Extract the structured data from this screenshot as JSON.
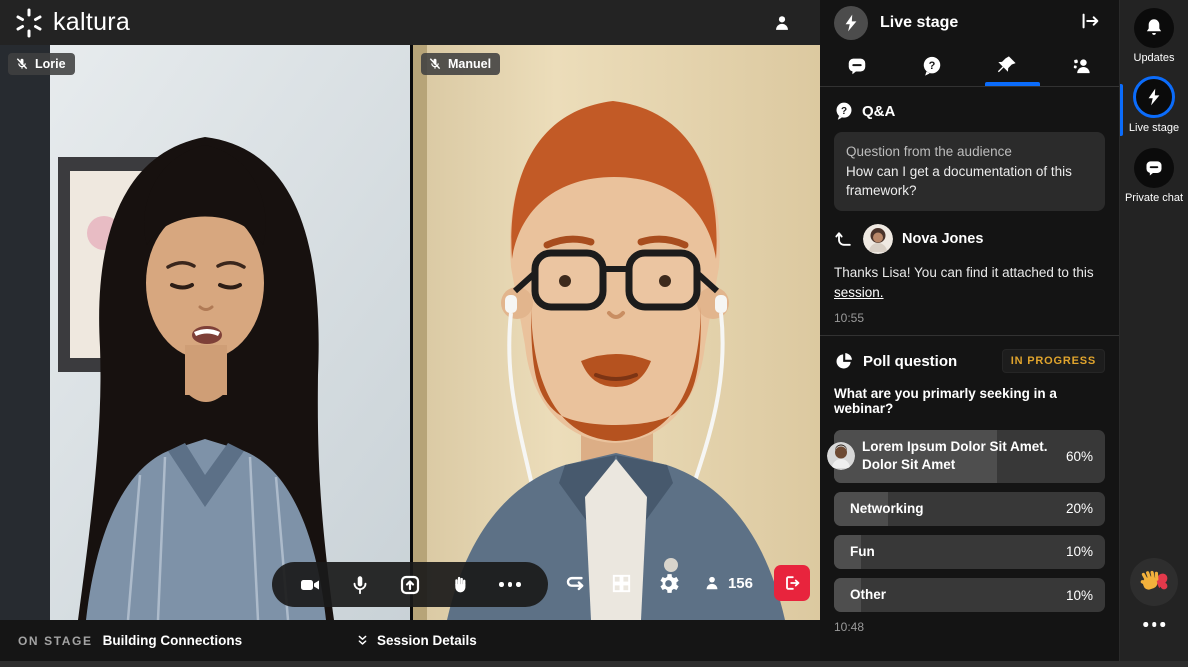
{
  "app": {
    "brand": "kaltura"
  },
  "videos": [
    {
      "label": "Lorie",
      "muted": true
    },
    {
      "label": "Manuel",
      "muted": true
    }
  ],
  "stage_controls": {
    "left_icons": [
      "camera-icon",
      "microphone-icon",
      "share-screen-icon",
      "raise-hand-icon",
      "more-icon"
    ],
    "right_icons": [
      "swap-layout-icon",
      "grid-view-icon",
      "settings-gear-icon",
      "participants-icon",
      "leave-icon"
    ],
    "participants_count": "156"
  },
  "panel": {
    "title": "Live stage",
    "tabs": [
      {
        "name": "chat",
        "active": false
      },
      {
        "name": "qa",
        "active": false
      },
      {
        "name": "pinned",
        "active": true
      },
      {
        "name": "participants",
        "active": false
      }
    ],
    "qa": {
      "section_title": "Q&A",
      "quote_line1": "Question from the audience",
      "quote_line2": "How can I get a documentation of this framework?",
      "reply_author": "Nova Jones",
      "reply_text_pre": "Thanks Lisa! You can find it attached to this ",
      "reply_link": "session.",
      "timestamp": "10:55"
    },
    "poll": {
      "section_title": "Poll question",
      "status_badge": "IN PROGRESS",
      "question": "What are you primarly seeking in a webinar?",
      "options": [
        {
          "label": "Lorem Ipsum Dolor Sit Amet. Dolor Sit Amet",
          "percent": "60%",
          "value": 60,
          "avatar": true
        },
        {
          "label": "Networking",
          "percent": "20%",
          "value": 20,
          "avatar": false
        },
        {
          "label": "Fun",
          "percent": "10%",
          "value": 10,
          "avatar": false
        },
        {
          "label": "Other",
          "percent": "10%",
          "value": 10,
          "avatar": false
        }
      ],
      "timestamp": "10:48"
    }
  },
  "rail": {
    "items": [
      {
        "label": "Updates",
        "icon": "bell-icon",
        "active": false
      },
      {
        "label": "Live stage",
        "icon": "lightning-icon",
        "active": true
      },
      {
        "label": "Private chat",
        "icon": "chat-bubble-icon",
        "active": false
      }
    ],
    "clap_icon": "clap-reaction-icon",
    "more_icon": "more-icon"
  },
  "bottom_bar": {
    "on_stage_label": "ON STAGE",
    "session_name": "Building Connections",
    "session_details_label": "Session Details"
  },
  "colors": {
    "accent_blue": "#0b6cfb",
    "badge_amber": "#e0a42d",
    "leave_red": "#e8243d",
    "topbar_bg": "#232323",
    "panel_bg": "#141414",
    "rail_bg": "#232323",
    "poll_bar_bg": "#383838",
    "poll_bar_fill": "#4e4e4e"
  }
}
